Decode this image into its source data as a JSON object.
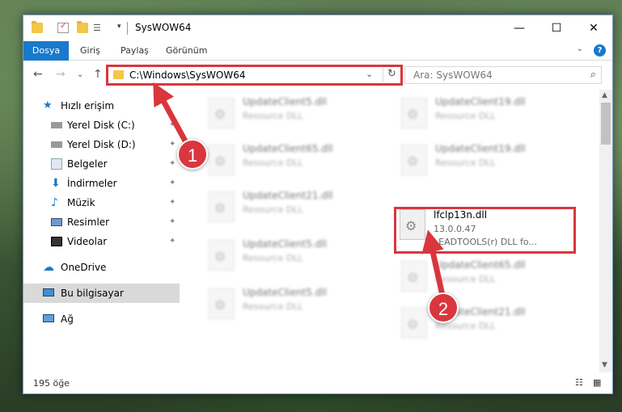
{
  "window": {
    "title": "SysWOW64",
    "minimize": "—",
    "maximize": "☐",
    "close": "✕"
  },
  "ribbon": {
    "tabs": [
      "Dosya",
      "Giriş",
      "Paylaş",
      "Görünüm"
    ],
    "expand": "⌄",
    "help": "?"
  },
  "nav": {
    "back": "←",
    "forward": "→",
    "recent": "⌄",
    "up": "↑"
  },
  "address": {
    "path": "C:\\Windows\\SysWOW64",
    "dropdown": "⌄",
    "refresh": "↻"
  },
  "search": {
    "placeholder": "Ara: SysWOW64",
    "icon": "⌕"
  },
  "sidebar": {
    "items": [
      {
        "label": "Hızlı erişim",
        "icon": "star-icon"
      },
      {
        "label": "Yerel Disk (C:)",
        "icon": "drive-icon",
        "pinned": true
      },
      {
        "label": "Yerel Disk (D:)",
        "icon": "drive-icon",
        "pinned": true
      },
      {
        "label": "Belgeler",
        "icon": "documents-icon",
        "pinned": true
      },
      {
        "label": "İndirmeler",
        "icon": "download-icon",
        "pinned": true
      },
      {
        "label": "Müzik",
        "icon": "music-icon",
        "pinned": true
      },
      {
        "label": "Resimler",
        "icon": "pictures-icon",
        "pinned": true
      },
      {
        "label": "Videolar",
        "icon": "video-icon",
        "pinned": true
      },
      {
        "label": "OneDrive",
        "icon": "cloud-icon"
      },
      {
        "label": "Bu bilgisayar",
        "icon": "computer-icon",
        "selected": true
      },
      {
        "label": "Ağ",
        "icon": "network-icon"
      }
    ],
    "pin_glyph": "📌"
  },
  "files": [
    {
      "name": "UpdateClient5.dll",
      "sub": "Resource DLL",
      "blurred": true
    },
    {
      "name": "UpdateClient19.dll",
      "sub": "Resource DLL",
      "blurred": true
    },
    {
      "name": "UpdateClient65.dll",
      "sub": "Resource DLL",
      "blurred": true
    },
    {
      "name": "UpdateClient19.dll",
      "sub": "Resource DLL",
      "blurred": true
    },
    {
      "name": "UpdateClient21.dll",
      "sub": "Resource DLL",
      "blurred": true
    },
    {
      "name": "lfclp13n.dll",
      "version": "13.0.0.47",
      "sub": "LEADTOOLS(r) DLL fo...",
      "blurred": false
    },
    {
      "name": "UpdateClient5.dll",
      "sub": "Resource DLL",
      "blurred": true
    },
    {
      "name": "UpdateClient65.dll",
      "sub": "Resource DLL",
      "blurred": true
    },
    {
      "name": "UpdateClient5.dll",
      "sub": "Resource DLL",
      "blurred": true
    },
    {
      "name": "UpdateClient21.dll",
      "sub": "Resource DLL",
      "blurred": true
    }
  ],
  "status": {
    "count": "195 öğe"
  },
  "callouts": [
    "1",
    "2"
  ],
  "colors": {
    "accent": "#1979ca",
    "highlight": "#d9363e",
    "folder": "#f4c64a"
  }
}
